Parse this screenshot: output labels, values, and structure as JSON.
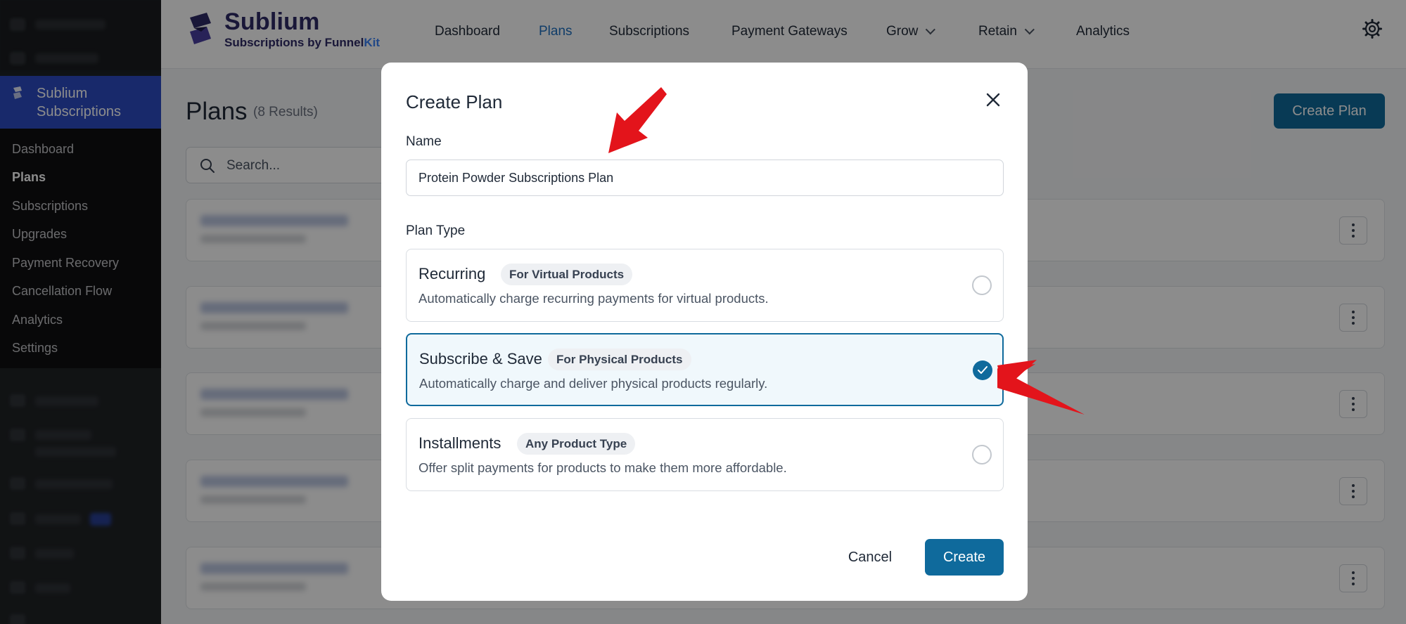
{
  "sidebar": {
    "active_item": "Sublium Subscriptions",
    "submenu": [
      "Dashboard",
      "Plans",
      "Subscriptions",
      "Upgrades",
      "Payment Recovery",
      "Cancellation Flow",
      "Analytics",
      "Settings"
    ],
    "current_submenu": "Plans"
  },
  "header": {
    "logo_title": "Sublium",
    "logo_sub_prefix": "Subscriptions by Funnel",
    "logo_sub_suffix": "Kit",
    "nav": [
      "Dashboard",
      "Plans",
      "Subscriptions",
      "Payment Gateways",
      "Grow",
      "Retain",
      "Analytics"
    ],
    "active_nav": "Plans"
  },
  "page": {
    "title": "Plans",
    "count": "(8 Results)",
    "create_plan_label": "Create Plan",
    "search_placeholder": "Search..."
  },
  "modal": {
    "title": "Create Plan",
    "name_label": "Name",
    "name_value": "Protein Powder Subscriptions Plan",
    "plan_type_label": "Plan Type",
    "options": [
      {
        "title": "Recurring",
        "badge": "For Virtual Products",
        "description": "Automatically charge recurring payments for virtual products.",
        "selected": false
      },
      {
        "title": "Subscribe & Save",
        "badge": "For Physical Products",
        "description": "Automatically charge and deliver physical products regularly.",
        "selected": true
      },
      {
        "title": "Installments",
        "badge": "Any Product Type",
        "description": "Offer split payments for products to make them more affordable.",
        "selected": false
      }
    ],
    "cancel_label": "Cancel",
    "create_label": "Create"
  },
  "colors": {
    "primary": "#0f6a9c",
    "sidebar_active": "#2c4cc4",
    "brand": "#2f2a66",
    "annotation_arrow": "#e3141b"
  }
}
